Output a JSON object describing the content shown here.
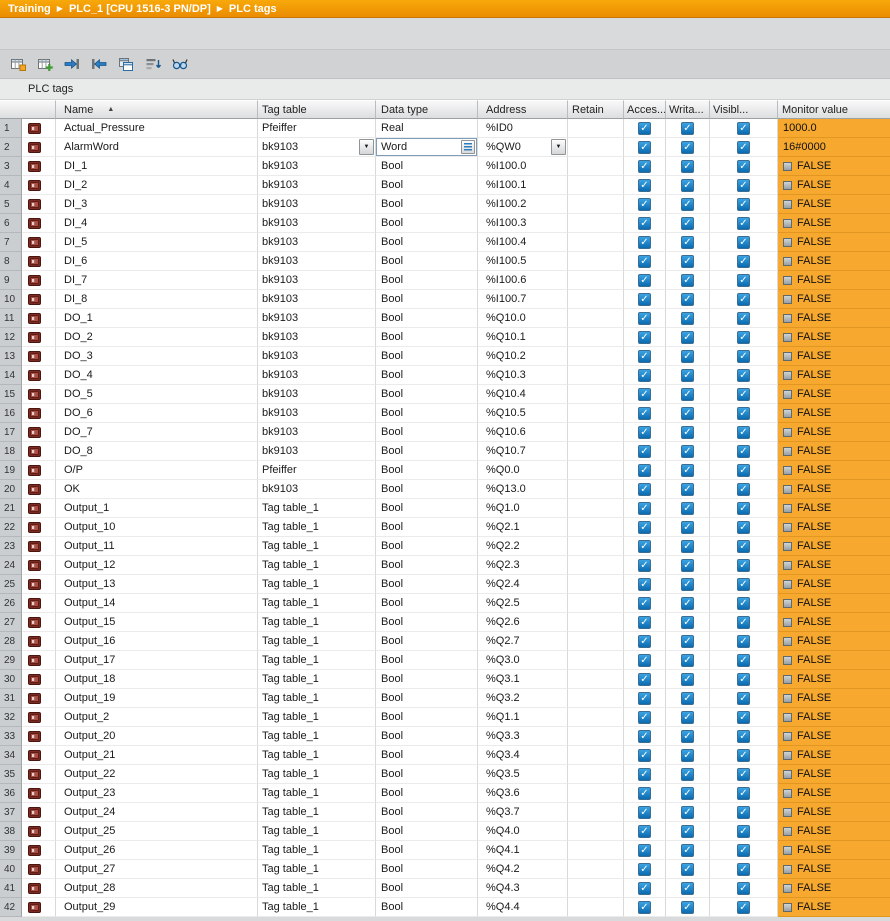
{
  "breadcrumb": {
    "items": [
      "Training",
      "PLC_1 [CPU 1516-3 PN/DP]",
      "PLC tags"
    ],
    "separator": "▶"
  },
  "toolbar": {
    "icons": [
      "insert-row-icon",
      "add-row-icon",
      "export-icon",
      "import-icon",
      "snapshot-icon",
      "sort-icon",
      "monitor-all-icon"
    ]
  },
  "section_title": "PLC tags",
  "icons": {
    "check": "✓",
    "dropdown": "▼",
    "sort_asc": "▲"
  },
  "colors": {
    "accent_orange": "#f6a82f",
    "breadcrumb_orange": "#ef9400",
    "checkbox_blue": "#0b6bb0"
  },
  "table": {
    "headers": {
      "name": "Name",
      "tag_table": "Tag table",
      "data_type": "Data type",
      "address": "Address",
      "retain": "Retain",
      "access": "Acces...",
      "write": "Writa...",
      "visible": "Visibl...",
      "monitor": "Monitor value"
    },
    "rows": [
      {
        "num": 1,
        "name": "Actual_Pressure",
        "tag_table": "Pfeiffer",
        "data_type": "Real",
        "address": "%ID0",
        "retain": false,
        "access": true,
        "write": true,
        "visible": true,
        "monitor": "1000.0",
        "monitor_kind": "text",
        "editing": false
      },
      {
        "num": 2,
        "name": "AlarmWord",
        "tag_table": "bk9103",
        "data_type": "Word",
        "address": "%QW0",
        "retain": false,
        "access": true,
        "write": true,
        "visible": true,
        "monitor": "16#0000",
        "monitor_kind": "text",
        "editing": true
      },
      {
        "num": 3,
        "name": "DI_1",
        "tag_table": "bk9103",
        "data_type": "Bool",
        "address": "%I100.0",
        "retain": false,
        "access": true,
        "write": true,
        "visible": true,
        "monitor": "FALSE",
        "monitor_kind": "bool",
        "editing": false
      },
      {
        "num": 4,
        "name": "DI_2",
        "tag_table": "bk9103",
        "data_type": "Bool",
        "address": "%I100.1",
        "retain": false,
        "access": true,
        "write": true,
        "visible": true,
        "monitor": "FALSE",
        "monitor_kind": "bool",
        "editing": false
      },
      {
        "num": 5,
        "name": "DI_3",
        "tag_table": "bk9103",
        "data_type": "Bool",
        "address": "%I100.2",
        "retain": false,
        "access": true,
        "write": true,
        "visible": true,
        "monitor": "FALSE",
        "monitor_kind": "bool",
        "editing": false
      },
      {
        "num": 6,
        "name": "DI_4",
        "tag_table": "bk9103",
        "data_type": "Bool",
        "address": "%I100.3",
        "retain": false,
        "access": true,
        "write": true,
        "visible": true,
        "monitor": "FALSE",
        "monitor_kind": "bool",
        "editing": false
      },
      {
        "num": 7,
        "name": "DI_5",
        "tag_table": "bk9103",
        "data_type": "Bool",
        "address": "%I100.4",
        "retain": false,
        "access": true,
        "write": true,
        "visible": true,
        "monitor": "FALSE",
        "monitor_kind": "bool",
        "editing": false
      },
      {
        "num": 8,
        "name": "DI_6",
        "tag_table": "bk9103",
        "data_type": "Bool",
        "address": "%I100.5",
        "retain": false,
        "access": true,
        "write": true,
        "visible": true,
        "monitor": "FALSE",
        "monitor_kind": "bool",
        "editing": false
      },
      {
        "num": 9,
        "name": "DI_7",
        "tag_table": "bk9103",
        "data_type": "Bool",
        "address": "%I100.6",
        "retain": false,
        "access": true,
        "write": true,
        "visible": true,
        "monitor": "FALSE",
        "monitor_kind": "bool",
        "editing": false
      },
      {
        "num": 10,
        "name": "DI_8",
        "tag_table": "bk9103",
        "data_type": "Bool",
        "address": "%I100.7",
        "retain": false,
        "access": true,
        "write": true,
        "visible": true,
        "monitor": "FALSE",
        "monitor_kind": "bool",
        "editing": false
      },
      {
        "num": 11,
        "name": "DO_1",
        "tag_table": "bk9103",
        "data_type": "Bool",
        "address": "%Q10.0",
        "retain": false,
        "access": true,
        "write": true,
        "visible": true,
        "monitor": "FALSE",
        "monitor_kind": "bool",
        "editing": false
      },
      {
        "num": 12,
        "name": "DO_2",
        "tag_table": "bk9103",
        "data_type": "Bool",
        "address": "%Q10.1",
        "retain": false,
        "access": true,
        "write": true,
        "visible": true,
        "monitor": "FALSE",
        "monitor_kind": "bool",
        "editing": false
      },
      {
        "num": 13,
        "name": "DO_3",
        "tag_table": "bk9103",
        "data_type": "Bool",
        "address": "%Q10.2",
        "retain": false,
        "access": true,
        "write": true,
        "visible": true,
        "monitor": "FALSE",
        "monitor_kind": "bool",
        "editing": false
      },
      {
        "num": 14,
        "name": "DO_4",
        "tag_table": "bk9103",
        "data_type": "Bool",
        "address": "%Q10.3",
        "retain": false,
        "access": true,
        "write": true,
        "visible": true,
        "monitor": "FALSE",
        "monitor_kind": "bool",
        "editing": false
      },
      {
        "num": 15,
        "name": "DO_5",
        "tag_table": "bk9103",
        "data_type": "Bool",
        "address": "%Q10.4",
        "retain": false,
        "access": true,
        "write": true,
        "visible": true,
        "monitor": "FALSE",
        "monitor_kind": "bool",
        "editing": false
      },
      {
        "num": 16,
        "name": "DO_6",
        "tag_table": "bk9103",
        "data_type": "Bool",
        "address": "%Q10.5",
        "retain": false,
        "access": true,
        "write": true,
        "visible": true,
        "monitor": "FALSE",
        "monitor_kind": "bool",
        "editing": false
      },
      {
        "num": 17,
        "name": "DO_7",
        "tag_table": "bk9103",
        "data_type": "Bool",
        "address": "%Q10.6",
        "retain": false,
        "access": true,
        "write": true,
        "visible": true,
        "monitor": "FALSE",
        "monitor_kind": "bool",
        "editing": false
      },
      {
        "num": 18,
        "name": "DO_8",
        "tag_table": "bk9103",
        "data_type": "Bool",
        "address": "%Q10.7",
        "retain": false,
        "access": true,
        "write": true,
        "visible": true,
        "monitor": "FALSE",
        "monitor_kind": "bool",
        "editing": false
      },
      {
        "num": 19,
        "name": "O/P",
        "tag_table": "Pfeiffer",
        "data_type": "Bool",
        "address": "%Q0.0",
        "retain": false,
        "access": true,
        "write": true,
        "visible": true,
        "monitor": "FALSE",
        "monitor_kind": "bool",
        "editing": false
      },
      {
        "num": 20,
        "name": "OK",
        "tag_table": "bk9103",
        "data_type": "Bool",
        "address": "%Q13.0",
        "retain": false,
        "access": true,
        "write": true,
        "visible": true,
        "monitor": "FALSE",
        "monitor_kind": "bool",
        "editing": false
      },
      {
        "num": 21,
        "name": "Output_1",
        "tag_table": "Tag table_1",
        "data_type": "Bool",
        "address": "%Q1.0",
        "retain": false,
        "access": true,
        "write": true,
        "visible": true,
        "monitor": "FALSE",
        "monitor_kind": "bool",
        "editing": false
      },
      {
        "num": 22,
        "name": "Output_10",
        "tag_table": "Tag table_1",
        "data_type": "Bool",
        "address": "%Q2.1",
        "retain": false,
        "access": true,
        "write": true,
        "visible": true,
        "monitor": "FALSE",
        "monitor_kind": "bool",
        "editing": false
      },
      {
        "num": 23,
        "name": "Output_11",
        "tag_table": "Tag table_1",
        "data_type": "Bool",
        "address": "%Q2.2",
        "retain": false,
        "access": true,
        "write": true,
        "visible": true,
        "monitor": "FALSE",
        "monitor_kind": "bool",
        "editing": false
      },
      {
        "num": 24,
        "name": "Output_12",
        "tag_table": "Tag table_1",
        "data_type": "Bool",
        "address": "%Q2.3",
        "retain": false,
        "access": true,
        "write": true,
        "visible": true,
        "monitor": "FALSE",
        "monitor_kind": "bool",
        "editing": false
      },
      {
        "num": 25,
        "name": "Output_13",
        "tag_table": "Tag table_1",
        "data_type": "Bool",
        "address": "%Q2.4",
        "retain": false,
        "access": true,
        "write": true,
        "visible": true,
        "monitor": "FALSE",
        "monitor_kind": "bool",
        "editing": false
      },
      {
        "num": 26,
        "name": "Output_14",
        "tag_table": "Tag table_1",
        "data_type": "Bool",
        "address": "%Q2.5",
        "retain": false,
        "access": true,
        "write": true,
        "visible": true,
        "monitor": "FALSE",
        "monitor_kind": "bool",
        "editing": false
      },
      {
        "num": 27,
        "name": "Output_15",
        "tag_table": "Tag table_1",
        "data_type": "Bool",
        "address": "%Q2.6",
        "retain": false,
        "access": true,
        "write": true,
        "visible": true,
        "monitor": "FALSE",
        "monitor_kind": "bool",
        "editing": false
      },
      {
        "num": 28,
        "name": "Output_16",
        "tag_table": "Tag table_1",
        "data_type": "Bool",
        "address": "%Q2.7",
        "retain": false,
        "access": true,
        "write": true,
        "visible": true,
        "monitor": "FALSE",
        "monitor_kind": "bool",
        "editing": false
      },
      {
        "num": 29,
        "name": "Output_17",
        "tag_table": "Tag table_1",
        "data_type": "Bool",
        "address": "%Q3.0",
        "retain": false,
        "access": true,
        "write": true,
        "visible": true,
        "monitor": "FALSE",
        "monitor_kind": "bool",
        "editing": false
      },
      {
        "num": 30,
        "name": "Output_18",
        "tag_table": "Tag table_1",
        "data_type": "Bool",
        "address": "%Q3.1",
        "retain": false,
        "access": true,
        "write": true,
        "visible": true,
        "monitor": "FALSE",
        "monitor_kind": "bool",
        "editing": false
      },
      {
        "num": 31,
        "name": "Output_19",
        "tag_table": "Tag table_1",
        "data_type": "Bool",
        "address": "%Q3.2",
        "retain": false,
        "access": true,
        "write": true,
        "visible": true,
        "monitor": "FALSE",
        "monitor_kind": "bool",
        "editing": false
      },
      {
        "num": 32,
        "name": "Output_2",
        "tag_table": "Tag table_1",
        "data_type": "Bool",
        "address": "%Q1.1",
        "retain": false,
        "access": true,
        "write": true,
        "visible": true,
        "monitor": "FALSE",
        "monitor_kind": "bool",
        "editing": false
      },
      {
        "num": 33,
        "name": "Output_20",
        "tag_table": "Tag table_1",
        "data_type": "Bool",
        "address": "%Q3.3",
        "retain": false,
        "access": true,
        "write": true,
        "visible": true,
        "monitor": "FALSE",
        "monitor_kind": "bool",
        "editing": false
      },
      {
        "num": 34,
        "name": "Output_21",
        "tag_table": "Tag table_1",
        "data_type": "Bool",
        "address": "%Q3.4",
        "retain": false,
        "access": true,
        "write": true,
        "visible": true,
        "monitor": "FALSE",
        "monitor_kind": "bool",
        "editing": false
      },
      {
        "num": 35,
        "name": "Output_22",
        "tag_table": "Tag table_1",
        "data_type": "Bool",
        "address": "%Q3.5",
        "retain": false,
        "access": true,
        "write": true,
        "visible": true,
        "monitor": "FALSE",
        "monitor_kind": "bool",
        "editing": false
      },
      {
        "num": 36,
        "name": "Output_23",
        "tag_table": "Tag table_1",
        "data_type": "Bool",
        "address": "%Q3.6",
        "retain": false,
        "access": true,
        "write": true,
        "visible": true,
        "monitor": "FALSE",
        "monitor_kind": "bool",
        "editing": false
      },
      {
        "num": 37,
        "name": "Output_24",
        "tag_table": "Tag table_1",
        "data_type": "Bool",
        "address": "%Q3.7",
        "retain": false,
        "access": true,
        "write": true,
        "visible": true,
        "monitor": "FALSE",
        "monitor_kind": "bool",
        "editing": false
      },
      {
        "num": 38,
        "name": "Output_25",
        "tag_table": "Tag table_1",
        "data_type": "Bool",
        "address": "%Q4.0",
        "retain": false,
        "access": true,
        "write": true,
        "visible": true,
        "monitor": "FALSE",
        "monitor_kind": "bool",
        "editing": false
      },
      {
        "num": 39,
        "name": "Output_26",
        "tag_table": "Tag table_1",
        "data_type": "Bool",
        "address": "%Q4.1",
        "retain": false,
        "access": true,
        "write": true,
        "visible": true,
        "monitor": "FALSE",
        "monitor_kind": "bool",
        "editing": false
      },
      {
        "num": 40,
        "name": "Output_27",
        "tag_table": "Tag table_1",
        "data_type": "Bool",
        "address": "%Q4.2",
        "retain": false,
        "access": true,
        "write": true,
        "visible": true,
        "monitor": "FALSE",
        "monitor_kind": "bool",
        "editing": false
      },
      {
        "num": 41,
        "name": "Output_28",
        "tag_table": "Tag table_1",
        "data_type": "Bool",
        "address": "%Q4.3",
        "retain": false,
        "access": true,
        "write": true,
        "visible": true,
        "monitor": "FALSE",
        "monitor_kind": "bool",
        "editing": false
      },
      {
        "num": 42,
        "name": "Output_29",
        "tag_table": "Tag table_1",
        "data_type": "Bool",
        "address": "%Q4.4",
        "retain": false,
        "access": true,
        "write": true,
        "visible": true,
        "monitor": "FALSE",
        "monitor_kind": "bool",
        "editing": false
      }
    ]
  }
}
